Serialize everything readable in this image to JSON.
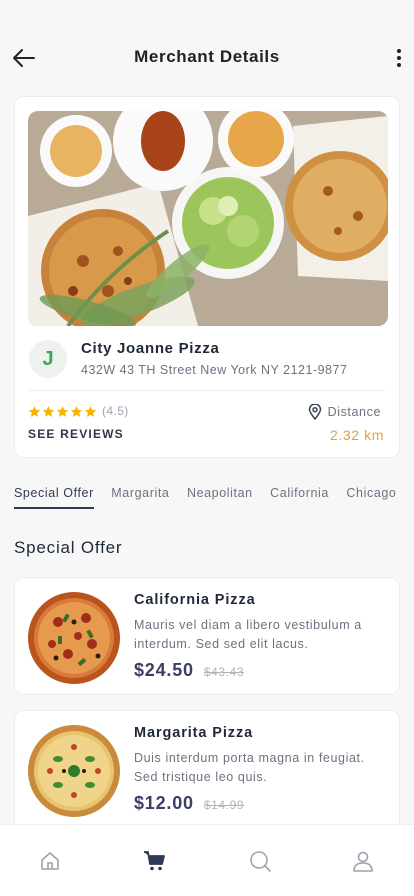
{
  "header": {
    "title": "Merchant Details",
    "back_icon": "arrow-left-icon",
    "more_icon": "more-vertical-icon"
  },
  "merchant": {
    "logo_letter": "J",
    "name": "City Joanne Pizza",
    "address": "432W 43 TH Street New York NY 2121-9877",
    "rating": 4.5,
    "rating_text": "(4.5)",
    "see_reviews": "SEE REVIEWS",
    "distance_label": "Distance",
    "distance_value": "2.32 km",
    "star_color": "#f5b400",
    "accent_color": "#e4a13b"
  },
  "tabs": [
    {
      "label": "Special Offer",
      "active": true
    },
    {
      "label": "Margarita",
      "active": false
    },
    {
      "label": "Neapolitan",
      "active": false
    },
    {
      "label": "California",
      "active": false
    },
    {
      "label": "Chicago",
      "active": false
    }
  ],
  "section": {
    "title": "Special Offer"
  },
  "products": [
    {
      "name": "California Pizza",
      "description": "Mauris vel diam a libero vestibulum a interdum. Sed sed elit lacus.",
      "price": "$24.50",
      "old_price": "$43.43"
    },
    {
      "name": "Margarita Pizza",
      "description": "Duis interdum porta magna in feugiat. Sed tristique leo quis.",
      "price": "$12.00",
      "old_price": "$14.99"
    }
  ],
  "bottom_nav": [
    {
      "icon": "home-icon",
      "active": false
    },
    {
      "icon": "cart-icon",
      "active": true
    },
    {
      "icon": "search-icon",
      "active": false
    },
    {
      "icon": "user-icon",
      "active": false
    }
  ]
}
